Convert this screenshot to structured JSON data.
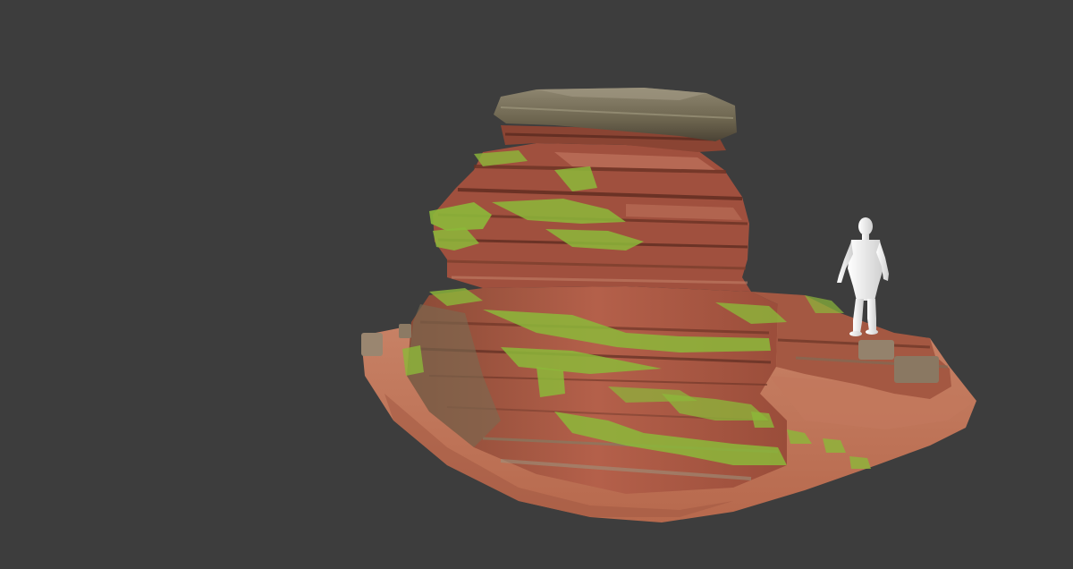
{
  "viewport": {
    "background_color": "#3d3d3d"
  },
  "scene": {
    "model": "red-sandstone-rock-formation",
    "has_scale_reference": true
  },
  "colors": {
    "sandstone_red": "#b0563f",
    "sandstone_dark": "#7c3a2a",
    "moss_green": "#8cb83a",
    "ground_soil": "#c47a5c",
    "top_slab": "#7b735d",
    "figure": "#e8e8e8"
  }
}
